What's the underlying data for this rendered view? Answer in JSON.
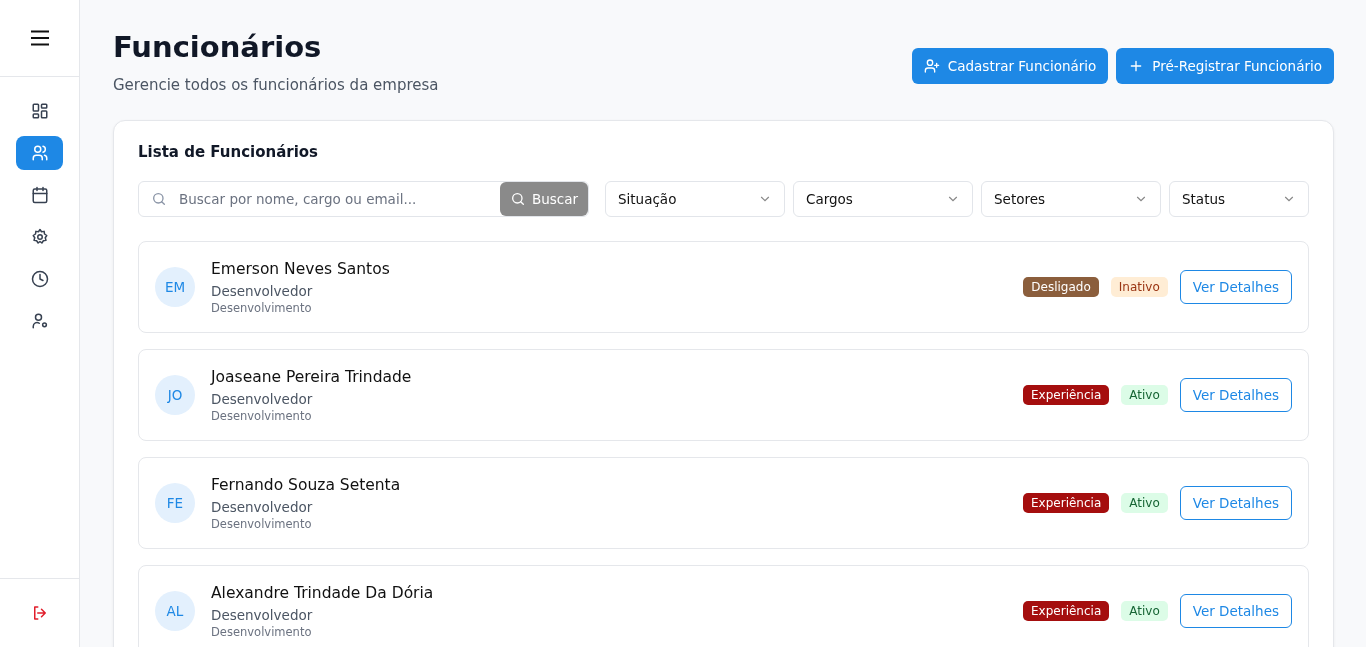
{
  "sidebar": {
    "items": [
      {
        "kind": "dashboard",
        "selected": false
      },
      {
        "kind": "users",
        "selected": true
      },
      {
        "kind": "calendar",
        "selected": false
      },
      {
        "kind": "settings",
        "selected": false
      },
      {
        "kind": "clock",
        "selected": false
      },
      {
        "kind": "user-settings",
        "selected": false
      }
    ]
  },
  "header": {
    "title": "Funcionários",
    "subtitle": "Gerencie todos os funcionários da empresa",
    "buttons": [
      {
        "kind": "add-user",
        "label": "Cadastrar Funcionário"
      },
      {
        "kind": "plus",
        "label": "Pré-Registrar Funcionário"
      }
    ]
  },
  "card": {
    "title": "Lista de Funcionários",
    "search": {
      "placeholder": "Buscar por nome, cargo ou email...",
      "button": "Buscar"
    },
    "filters": [
      "Situação",
      "Cargos",
      "Setores",
      "Status"
    ],
    "employees": [
      {
        "initials": "EM",
        "name": "Emerson Neves Santos",
        "role": "Desenvolvedor",
        "sector": "Desenvolvimento",
        "situation": {
          "label": "Desligado",
          "color": "#8b5e3c"
        },
        "status": {
          "label": "Inativo",
          "kind": "inactive"
        },
        "action": "Ver Detalhes"
      },
      {
        "initials": "JO",
        "name": "Joaseane Pereira Trindade",
        "role": "Desenvolvedor",
        "sector": "Desenvolvimento",
        "situation": {
          "label": "Experiência",
          "color": "#a50e0e"
        },
        "status": {
          "label": "Ativo",
          "kind": "active"
        },
        "action": "Ver Detalhes"
      },
      {
        "initials": "FE",
        "name": "Fernando Souza Setenta",
        "role": "Desenvolvedor",
        "sector": "Desenvolvimento",
        "situation": {
          "label": "Experiência",
          "color": "#a50e0e"
        },
        "status": {
          "label": "Ativo",
          "kind": "active"
        },
        "action": "Ver Detalhes"
      },
      {
        "initials": "AL",
        "name": "Alexandre Trindade Da Dória",
        "role": "Desenvolvedor",
        "sector": "Desenvolvimento",
        "situation": {
          "label": "Experiência",
          "color": "#a50e0e"
        },
        "status": {
          "label": "Ativo",
          "kind": "active"
        },
        "action": "Ver Detalhes"
      }
    ]
  }
}
